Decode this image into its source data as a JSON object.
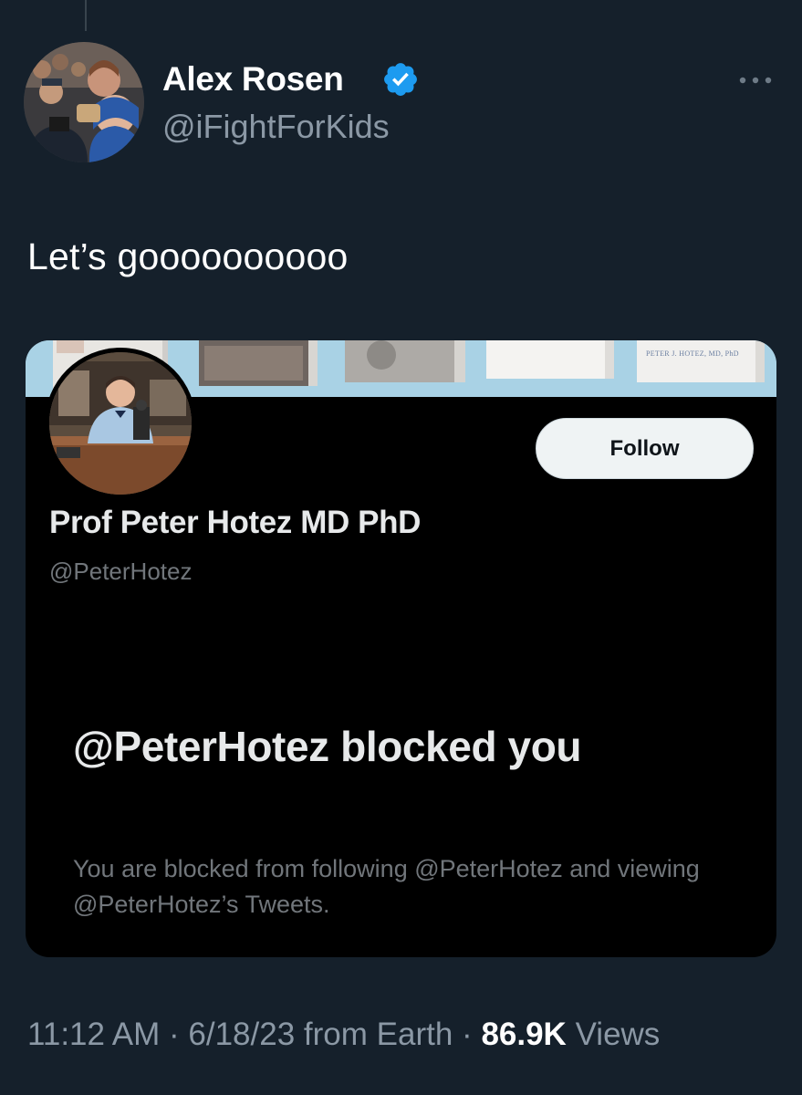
{
  "author": {
    "name": "Alex Rosen",
    "handle": "@iFightForKids",
    "verified": true
  },
  "tweet": {
    "text": "Let’s goooooooooo"
  },
  "embedded_profile": {
    "banner_text": "PETER J. HOTEZ, MD, PhD",
    "name": "Prof Peter Hotez MD PhD",
    "handle": "@PeterHotez",
    "follow_label": "Follow",
    "blocked_title": "@PeterHotez blocked you",
    "blocked_description": "You are blocked from following @PeterHotez and viewing @PeterHotez’s Tweets."
  },
  "meta": {
    "time": "11:12 AM",
    "date": "6/18/23",
    "source": "from Earth",
    "views_count": "86.9K",
    "views_label": "Views",
    "separator": "·"
  },
  "colors": {
    "background": "#15202b",
    "verified_blue": "#1d9bf0",
    "secondary_text": "#8b98a5",
    "card_background": "#000000"
  },
  "icons": {
    "verified": "verified-badge-icon",
    "more": "more-dots-icon"
  }
}
